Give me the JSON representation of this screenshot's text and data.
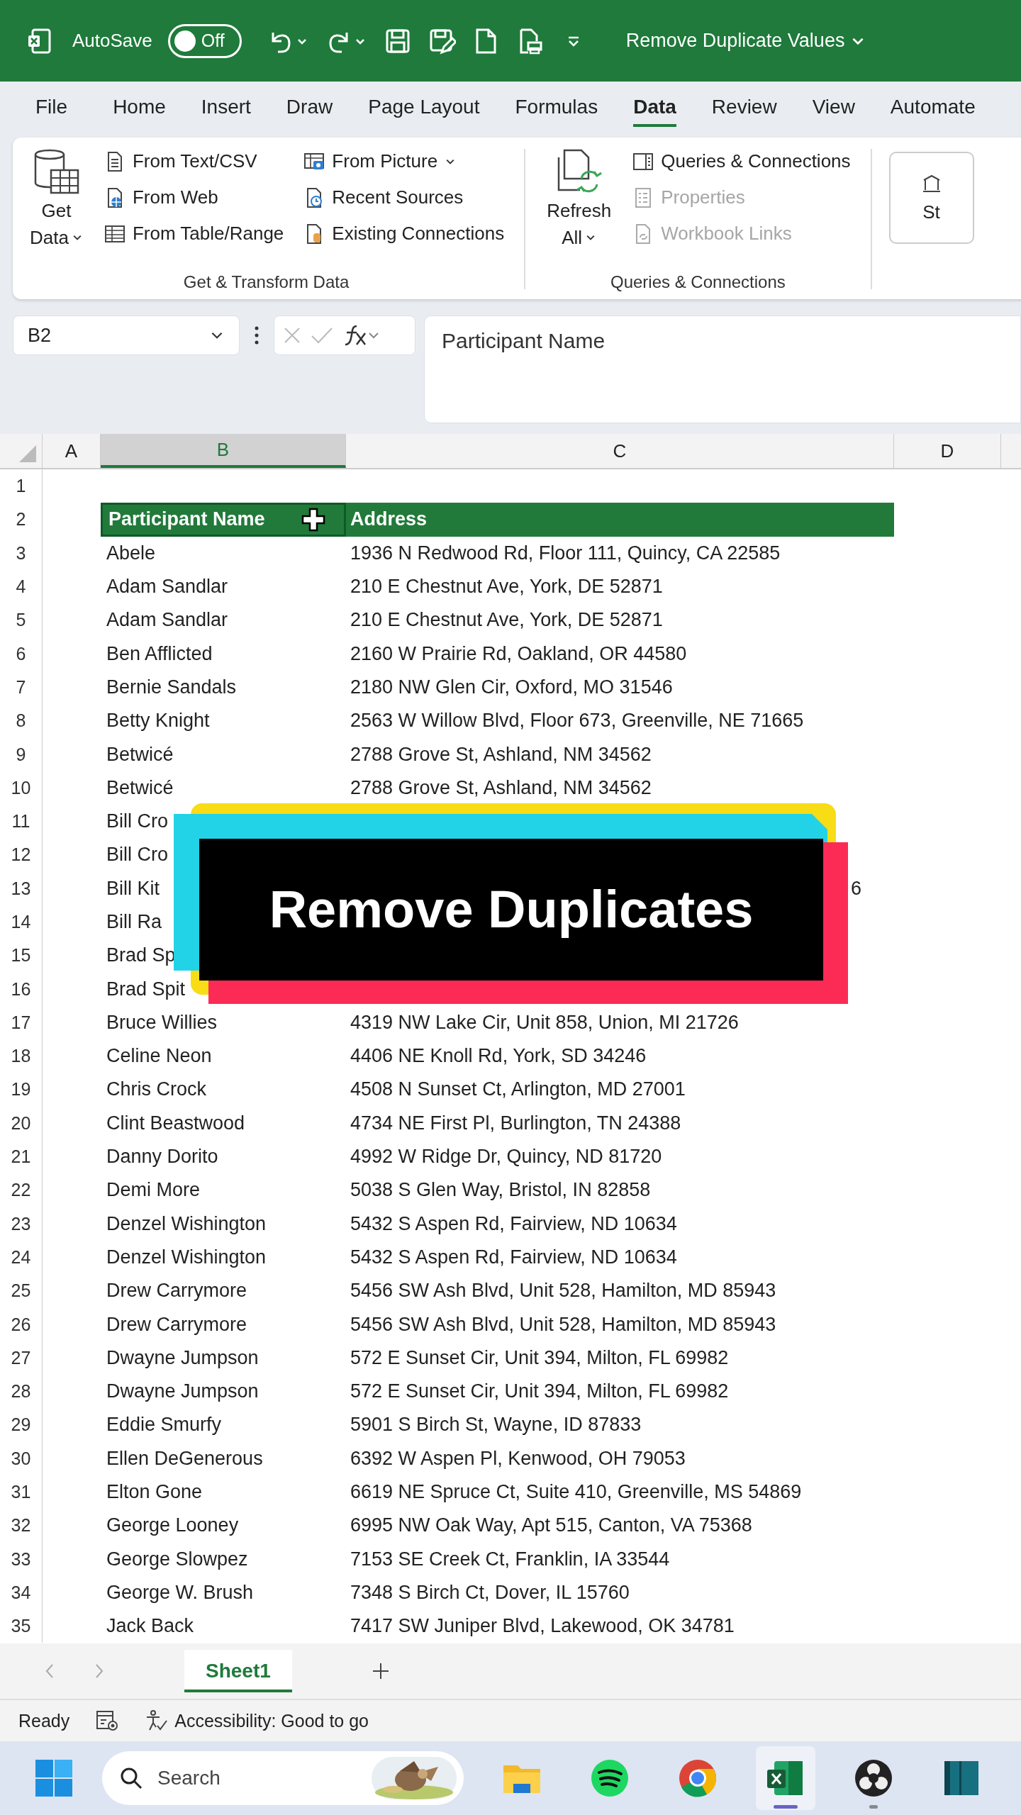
{
  "title_bar": {
    "autosave": {
      "label": "AutoSave",
      "state": "Off",
      "on": false
    },
    "title": "Remove Duplicate Values"
  },
  "menu_tabs": [
    {
      "label": "File",
      "selected": false
    },
    {
      "label": "Home",
      "selected": false
    },
    {
      "label": "Insert",
      "selected": false
    },
    {
      "label": "Draw",
      "selected": false
    },
    {
      "label": "Page Layout",
      "selected": false
    },
    {
      "label": "Formulas",
      "selected": false
    },
    {
      "label": "Data",
      "selected": true
    },
    {
      "label": "Review",
      "selected": false
    },
    {
      "label": "View",
      "selected": false
    },
    {
      "label": "Automate",
      "selected": false
    }
  ],
  "ribbon": {
    "groups": [
      {
        "label": "Get & Transform Data",
        "large": {
          "lines": [
            "Get",
            "Data"
          ],
          "kind": "database",
          "dropdown": true
        },
        "columns": [
          [
            {
              "label": "From Text/CSV",
              "kind": "text-file",
              "disabled": false,
              "dropdown": false
            },
            {
              "label": "From Web",
              "kind": "web-file",
              "disabled": false,
              "dropdown": false
            },
            {
              "label": "From Table/Range",
              "kind": "table",
              "disabled": false,
              "dropdown": false
            }
          ],
          [
            {
              "label": "From Picture",
              "kind": "picture-table",
              "disabled": false,
              "dropdown": true
            },
            {
              "label": "Recent Sources",
              "kind": "clock-file",
              "disabled": false,
              "dropdown": false
            },
            {
              "label": "Existing Connections",
              "kind": "db-file",
              "disabled": false,
              "dropdown": false
            }
          ]
        ]
      },
      {
        "label": "Queries & Connections",
        "large": {
          "lines": [
            "Refresh",
            "All"
          ],
          "kind": "refresh",
          "dropdown": true
        },
        "columns": [
          [
            {
              "label": "Queries & Connections",
              "kind": "panel",
              "disabled": false,
              "dropdown": false
            },
            {
              "label": "Properties",
              "kind": "list",
              "disabled": true,
              "dropdown": false
            },
            {
              "label": "Workbook Links",
              "kind": "link-file",
              "disabled": true,
              "dropdown": false
            }
          ]
        ]
      }
    ],
    "partial_button": "St"
  },
  "formula_bar": {
    "name_box": "B2",
    "formula": "Participant Name"
  },
  "columns": [
    {
      "label": "A",
      "selected": false
    },
    {
      "label": "B",
      "selected": true
    },
    {
      "label": "C",
      "selected": false
    },
    {
      "label": "D",
      "selected": false
    }
  ],
  "rows": [
    {
      "num": "1",
      "kind": "blank"
    },
    {
      "num": "2",
      "kind": "header",
      "name": "Participant Name",
      "address": "Address"
    },
    {
      "num": "3",
      "kind": "data",
      "name": "Abele",
      "address": "1936 N Redwood Rd, Floor 111, Quincy, CA 22585"
    },
    {
      "num": "4",
      "kind": "data",
      "name": "Adam Sandlar",
      "address": "210 E Chestnut Ave, York, DE 52871"
    },
    {
      "num": "5",
      "kind": "data",
      "name": "Adam Sandlar",
      "address": "210 E Chestnut Ave, York, DE 52871"
    },
    {
      "num": "6",
      "kind": "data",
      "name": "Ben Afflicted",
      "address": "2160 W Prairie Rd, Oakland, OR 44580"
    },
    {
      "num": "7",
      "kind": "data",
      "name": "Bernie Sandals",
      "address": "2180 NW Glen Cir, Oxford, MO 31546"
    },
    {
      "num": "8",
      "kind": "data",
      "name": "Betty Knight",
      "address": "2563 W Willow Blvd, Floor 673, Greenville, NE 71665"
    },
    {
      "num": "9",
      "kind": "data",
      "name": "Betwicé",
      "address": "2788 Grove St, Ashland, NM 34562"
    },
    {
      "num": "10",
      "kind": "data",
      "name": "Betwicé",
      "address": "2788 Grove St, Ashland, NM 34562"
    },
    {
      "num": "11",
      "kind": "data",
      "name": "Bill Cro"
    },
    {
      "num": "12",
      "kind": "data",
      "name": "Bill Cro"
    },
    {
      "num": "13",
      "kind": "partial",
      "name": "Bill Kit",
      "address": "6"
    },
    {
      "num": "14",
      "kind": "data",
      "name": "Bill Ra"
    },
    {
      "num": "15",
      "kind": "data",
      "name": "Brad Sp"
    },
    {
      "num": "16",
      "kind": "data",
      "name": "Brad Spit"
    },
    {
      "num": "17",
      "kind": "data",
      "name": "Bruce Willies",
      "address": "4319 NW Lake Cir, Unit 858, Union, MI 21726"
    },
    {
      "num": "18",
      "kind": "data",
      "name": "Celine Neon",
      "address": "4406 NE Knoll Rd, York, SD 34246"
    },
    {
      "num": "19",
      "kind": "data",
      "name": "Chris Crock",
      "address": "4508 N Sunset Ct, Arlington, MD 27001"
    },
    {
      "num": "20",
      "kind": "data",
      "name": "Clint Beastwood",
      "address": "4734 NE First Pl, Burlington, TN 24388"
    },
    {
      "num": "21",
      "kind": "data",
      "name": "Danny Dorito",
      "address": "4992 W Ridge Dr, Quincy, ND 81720"
    },
    {
      "num": "22",
      "kind": "data",
      "name": "Demi More",
      "address": "5038 S Glen Way, Bristol, IN 82858"
    },
    {
      "num": "23",
      "kind": "data",
      "name": "Denzel Wishington",
      "address": "5432 S Aspen Rd, Fairview, ND 10634"
    },
    {
      "num": "24",
      "kind": "data",
      "name": "Denzel Wishington",
      "address": "5432 S Aspen Rd, Fairview, ND 10634"
    },
    {
      "num": "25",
      "kind": "data",
      "name": "Drew Carrymore",
      "address": "5456 SW Ash Blvd, Unit 528, Hamilton, MD 85943"
    },
    {
      "num": "26",
      "kind": "data",
      "name": "Drew Carrymore",
      "address": "5456 SW Ash Blvd, Unit 528, Hamilton, MD 85943"
    },
    {
      "num": "27",
      "kind": "data",
      "name": "Dwayne Jumpson",
      "address": "572 E Sunset Cir, Unit 394, Milton, FL 69982"
    },
    {
      "num": "28",
      "kind": "data",
      "name": "Dwayne Jumpson",
      "address": "572 E Sunset Cir, Unit 394, Milton, FL 69982"
    },
    {
      "num": "29",
      "kind": "data",
      "name": "Eddie Smurfy",
      "address": "5901 S Birch St, Wayne, ID 87833"
    },
    {
      "num": "30",
      "kind": "data",
      "name": "Ellen DeGenerous",
      "address": "6392 W Aspen Pl, Kenwood, OH 79053"
    },
    {
      "num": "31",
      "kind": "data",
      "name": "Elton Gone",
      "address": "6619 NE Spruce Ct, Suite 410, Greenville, MS 54869"
    },
    {
      "num": "32",
      "kind": "data",
      "name": "George Looney",
      "address": "6995 NW Oak Way, Apt 515, Canton, VA 75368"
    },
    {
      "num": "33",
      "kind": "data",
      "name": "George Slowpez",
      "address": "7153 SE Creek Ct, Franklin, IA 33544"
    },
    {
      "num": "34",
      "kind": "data",
      "name": "George W. Brush",
      "address": "7348 S Birch Ct, Dover, IL 15760"
    },
    {
      "num": "35",
      "kind": "data",
      "name": "Jack Back",
      "address": "7417 SW Juniper Blvd, Lakewood, OK 34781"
    }
  ],
  "overlay": {
    "title": "Remove Duplicates"
  },
  "sheet_tabs": [
    {
      "label": "Sheet1",
      "selected": true
    }
  ],
  "status_bar": {
    "mode": "Ready",
    "accessibility": "Accessibility: Good to go"
  },
  "taskbar": {
    "search": {
      "placeholder": "Search"
    },
    "apps": [
      {
        "kind": "folder",
        "active": false,
        "running": false
      },
      {
        "kind": "music",
        "active": false,
        "running": false
      },
      {
        "kind": "browser",
        "active": false,
        "running": false
      },
      {
        "kind": "spreadsheet",
        "active": true,
        "running": true
      },
      {
        "kind": "aperture",
        "active": false,
        "running": true
      },
      {
        "kind": "book",
        "active": false,
        "running": false
      }
    ]
  }
}
